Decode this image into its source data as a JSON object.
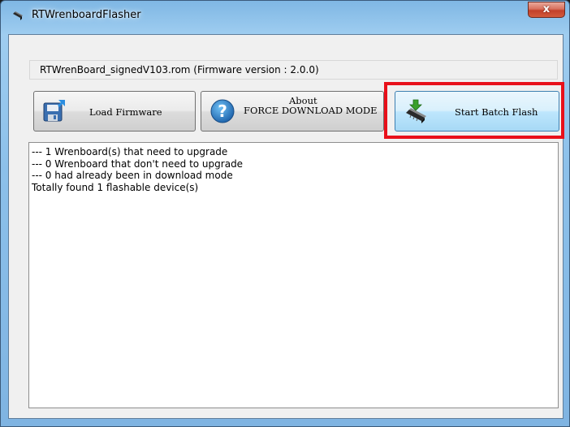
{
  "window": {
    "title": "RTWrenboardFlasher",
    "close_label": "x"
  },
  "firmware": {
    "label": "RTWrenBoard_signedV103.rom (Firmware version : 2.0.0)"
  },
  "buttons": {
    "load_firmware": "Load Firmware",
    "about_line1": "About",
    "about_line2": "FORCE DOWNLOAD MODE",
    "start_batch_flash": "Start Batch Flash"
  },
  "icons": {
    "app": "chip-icon",
    "load": "floppy-disk-icon",
    "about": "help-icon",
    "start": "flash-chip-icon"
  },
  "log": {
    "lines": [
      "--- 1 Wrenboard(s) that need to upgrade",
      "--- 0 Wrenboard that don't need to upgrade",
      "--- 0 had already been in download mode",
      "Totally found 1 flashable device(s)"
    ]
  },
  "colors": {
    "highlight": "#e8101a",
    "close_button": "#c2402a"
  }
}
